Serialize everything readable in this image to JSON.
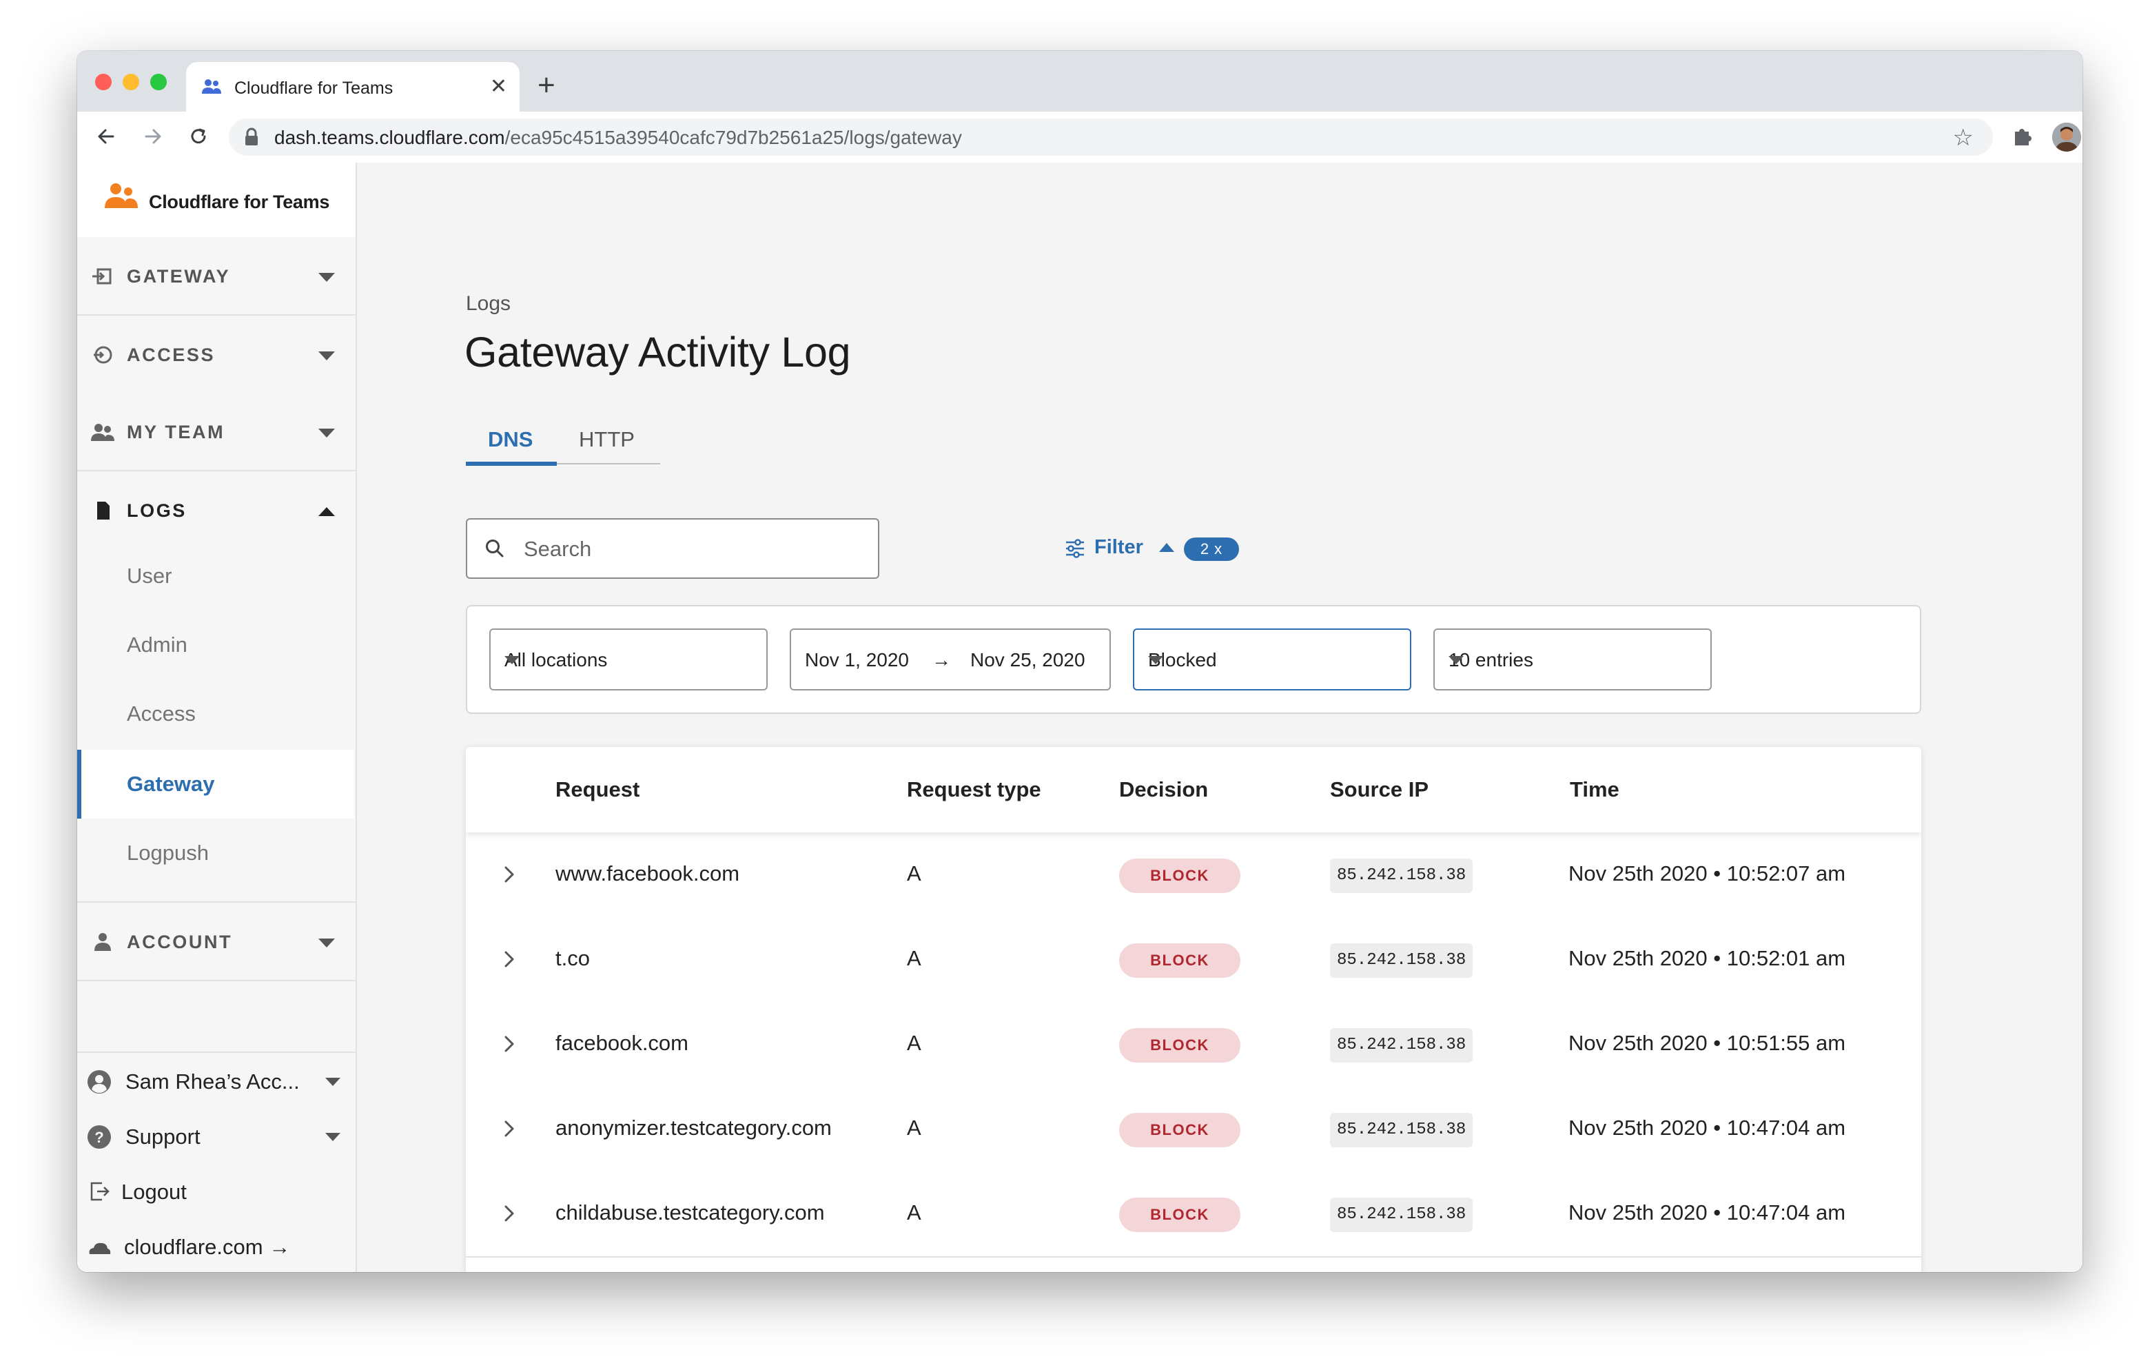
{
  "browser": {
    "tab_title": "Cloudflare for Teams",
    "url_host": "dash.teams.cloudflare.com",
    "url_path": "/eca95c4515a39540cafc79d7b2561a25/logs/gateway"
  },
  "sidebar": {
    "brand": "Cloudflare for Teams",
    "sections": [
      {
        "label": "GATEWAY",
        "icon": "gateway-icon"
      },
      {
        "label": "ACCESS",
        "icon": "access-icon"
      },
      {
        "label": "MY TEAM",
        "icon": "team-icon"
      },
      {
        "label": "LOGS",
        "icon": "document-icon"
      },
      {
        "label": "ACCOUNT",
        "icon": "person-icon"
      }
    ],
    "logs_items": [
      {
        "label": "User"
      },
      {
        "label": "Admin"
      },
      {
        "label": "Access"
      },
      {
        "label": "Gateway"
      },
      {
        "label": "Logpush"
      }
    ],
    "footer": {
      "account": "Sam Rhea’s Acc...",
      "support": "Support",
      "logout": "Logout",
      "site": "cloudflare.com →"
    }
  },
  "main": {
    "breadcrumb": "Logs",
    "title": "Gateway Activity Log",
    "tabs": [
      {
        "label": "DNS"
      },
      {
        "label": "HTTP"
      }
    ],
    "search_placeholder": "Search",
    "filter": {
      "label": "Filter",
      "count": "2 x"
    },
    "filters": {
      "location": "All locations",
      "date_from": "Nov 1, 2020",
      "date_arrow": "→",
      "date_to": "Nov 25, 2020",
      "decision": "Blocked",
      "entries": "10 entries"
    },
    "table": {
      "columns": [
        "Request",
        "Request type",
        "Decision",
        "Source IP",
        "Time"
      ],
      "rows": [
        {
          "request": "www.facebook.com",
          "type": "A",
          "decision": "BLOCK",
          "ip": "85.242.158.38",
          "time": "Nov 25th 2020 • 10:52:07 am"
        },
        {
          "request": "t.co",
          "type": "A",
          "decision": "BLOCK",
          "ip": "85.242.158.38",
          "time": "Nov 25th 2020 • 10:52:01 am"
        },
        {
          "request": "facebook.com",
          "type": "A",
          "decision": "BLOCK",
          "ip": "85.242.158.38",
          "time": "Nov 25th 2020 • 10:51:55 am"
        },
        {
          "request": "anonymizer.testcategory.com",
          "type": "A",
          "decision": "BLOCK",
          "ip": "85.242.158.38",
          "time": "Nov 25th 2020 • 10:47:04 am"
        },
        {
          "request": "childabuse.testcategory.com",
          "type": "A",
          "decision": "BLOCK",
          "ip": "85.242.158.38",
          "time": "Nov 25th 2020 • 10:47:04 am"
        }
      ]
    }
  },
  "colors": {
    "accent": "#2c6eb0",
    "brand_orange": "#f38020",
    "block_bg": "#f4d6d9",
    "block_text": "#b1272f"
  }
}
